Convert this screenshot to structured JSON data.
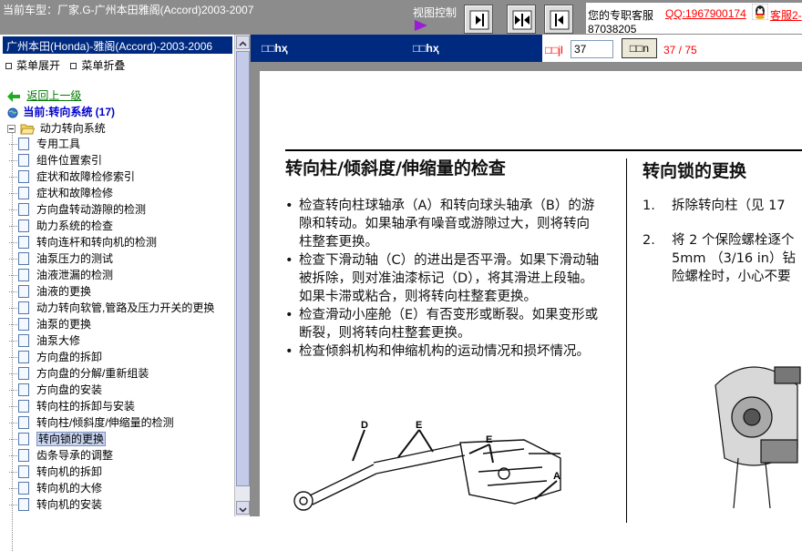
{
  "top": {
    "title": "当前车型：厂家.G-广州本田雅阁(Accord)2003-2007",
    "view_control_label": "视图控制",
    "service_label": "您的专职客服",
    "qq_link": "QQ:1967900174",
    "kefu_link": "客服2-",
    "phone": "87038205"
  },
  "sidebar": {
    "car_header": "广州本田(Honda)-雅阁(Accord)-2003-2006",
    "expand_label": "菜单展开",
    "collapse_label": "菜单折叠",
    "back_label": "返回上一级",
    "current_label": "当前:转向系统 (17)",
    "root_label": "动力转向系统",
    "items": [
      "专用工具",
      "组件位置索引",
      "症状和故障检修索引",
      "症状和故障检修",
      "方向盘转动游隙的检测",
      "助力系统的检查",
      "转向连杆和转向机的检测",
      "油泵压力的测试",
      "油液泄漏的检测",
      "油液的更换",
      "动力转向软管,管路及压力开关的更换",
      "油泵的更换",
      "油泵大修",
      "方向盘的拆卸",
      "方向盘的分解/重新组装",
      "方向盘的安装",
      "转向柱的拆卸与安装",
      "转向柱/倾斜度/伸缩量的检测",
      "转向锁的更换",
      "齿条导承的调整",
      "转向机的拆卸",
      "转向机的大修",
      "转向机的安装"
    ],
    "selected_index": 18
  },
  "viewer": {
    "header_left": "□□hҳ",
    "header_mid": "□□hҳ",
    "page_label": "□□jl",
    "page_value": "37",
    "go_label": "□□n",
    "page_count": "37 / 75"
  },
  "document": {
    "left_title": "转向柱/倾斜度/伸缩量的检查",
    "bullets": [
      "检查转向柱球轴承（A）和转向球头轴承（B）的游隙和转动。如果轴承有噪音或游隙过大，则将转向柱整套更换。",
      "检查下滑动轴（C）的进出是否平滑。如果下滑动轴被拆除，则对准油漆标记（D），将其滑进上段轴。如果卡滞或粘合，则将转向柱整套更换。",
      "检查滑动小座舱（E）有否变形或断裂。如果变形或断裂，则将转向柱整套更换。",
      "检查倾斜机构和伸缩机构的运动情况和损坏情况。"
    ],
    "right_title": "转向锁的更换",
    "steps": [
      {
        "num": "1.",
        "text": "拆除转向柱（见 17"
      },
      {
        "num": "2.",
        "text": "将 2 个保险螺栓逐个"
      },
      {
        "num": "",
        "text": "5mm （3/16 in）钻"
      },
      {
        "num": "",
        "text": "险螺栓时，小心不要"
      }
    ],
    "diagram_labels": [
      "D",
      "E",
      "E",
      "A"
    ]
  }
}
